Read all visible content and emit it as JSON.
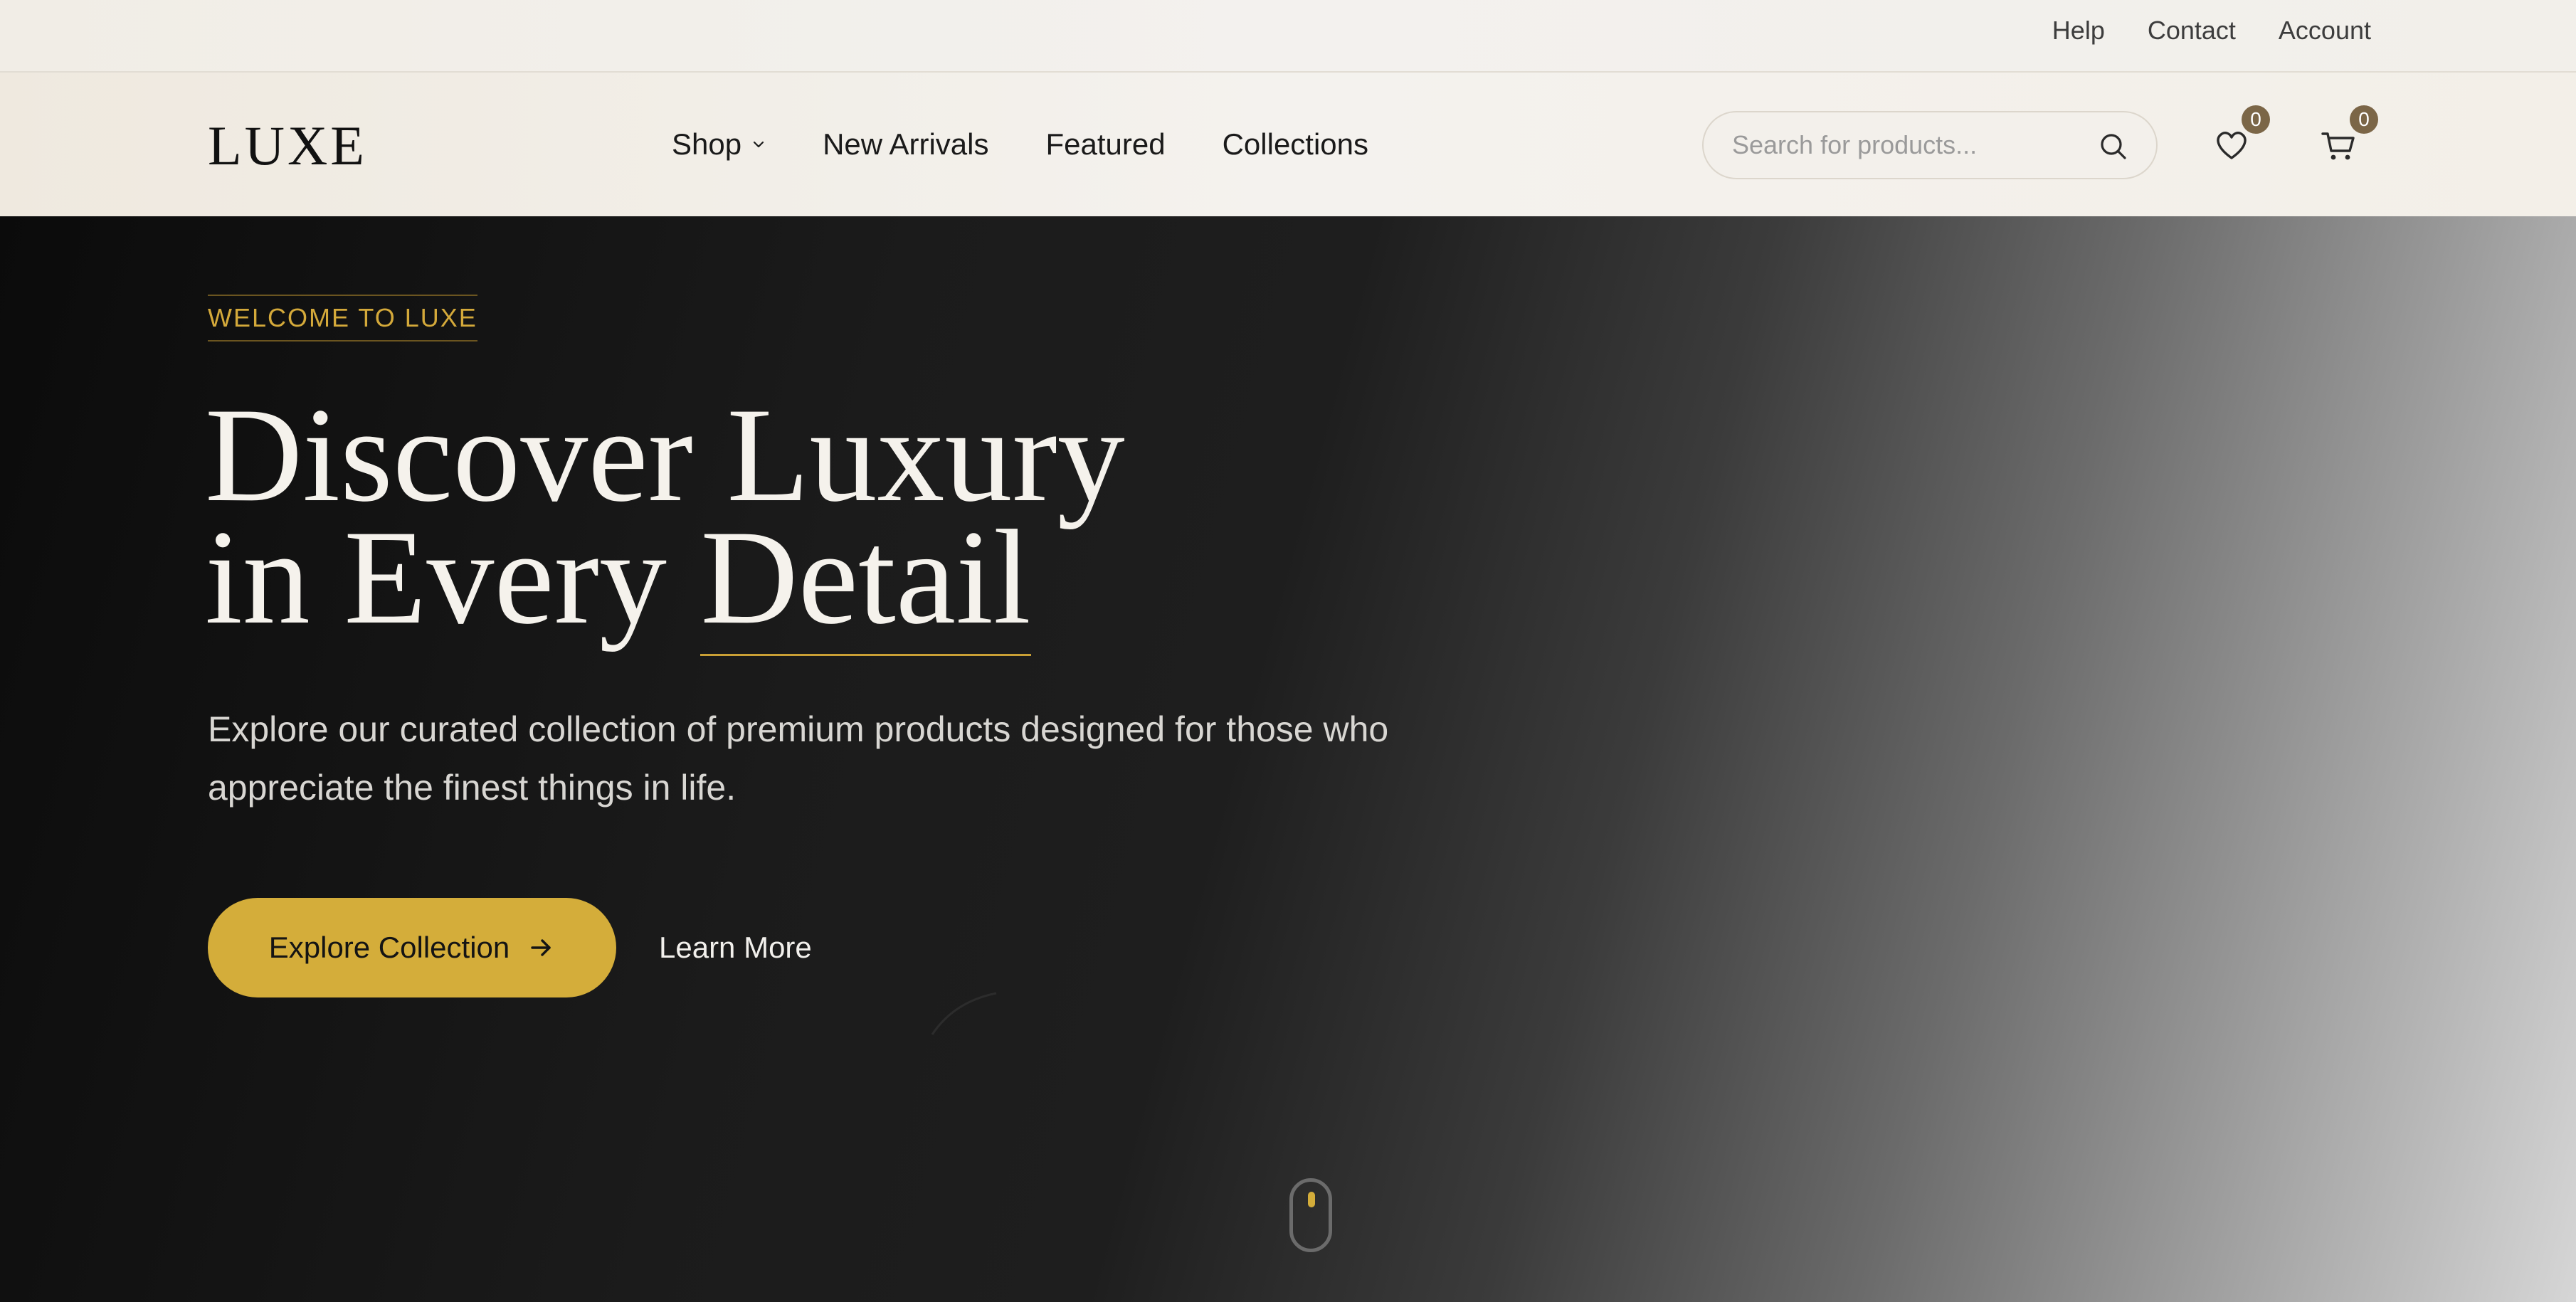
{
  "utility": {
    "links": [
      "Help",
      "Contact",
      "Account"
    ]
  },
  "header": {
    "logo": "LUXE",
    "nav": [
      "Shop",
      "New Arrivals",
      "Featured",
      "Collections"
    ],
    "search_placeholder": "Search for products...",
    "wishlist_count": "0",
    "cart_count": "0"
  },
  "hero": {
    "tag": "WELCOME TO LUXE",
    "title_line1": "Discover Luxury",
    "title_line2_a": "in Every ",
    "title_line2_b": "Detail",
    "subtitle": "Explore our curated collection of premium products designed for those who appreciate the finest things in life.",
    "cta_label": "Explore Collection",
    "secondary_label": "Learn More"
  },
  "colors": {
    "accent": "#d4ad3a",
    "badge": "#7b6647",
    "dark": "#1b1b1b"
  },
  "icons": [
    "chevron-down-icon",
    "search-icon",
    "heart-icon",
    "cart-icon",
    "arrow-right-icon",
    "mouse-scroll-icon"
  ]
}
